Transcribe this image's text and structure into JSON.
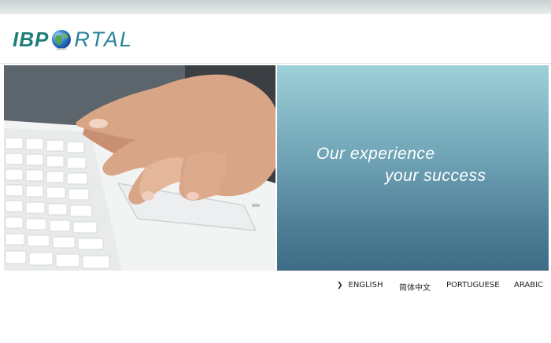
{
  "logo": {
    "part1": "IBP",
    "part2": "RTAL",
    "alt": "IBPORTAL"
  },
  "hero": {
    "slogan_line1": "Our experience",
    "slogan_line2": "your success"
  },
  "languages": {
    "items": [
      {
        "label": "ENGLISH",
        "active": true
      },
      {
        "label": "简体中文"
      },
      {
        "label": "PORTUGUESE"
      },
      {
        "label": "ARABIC"
      }
    ]
  },
  "colors": {
    "brand_green": "#1e7f78",
    "brand_teal": "#26849a",
    "panel_top": "#9fd0d9",
    "panel_bottom": "#3f6c86"
  },
  "icons": {
    "globe": "globe-icon",
    "arrow": "chevron-right-icon"
  }
}
